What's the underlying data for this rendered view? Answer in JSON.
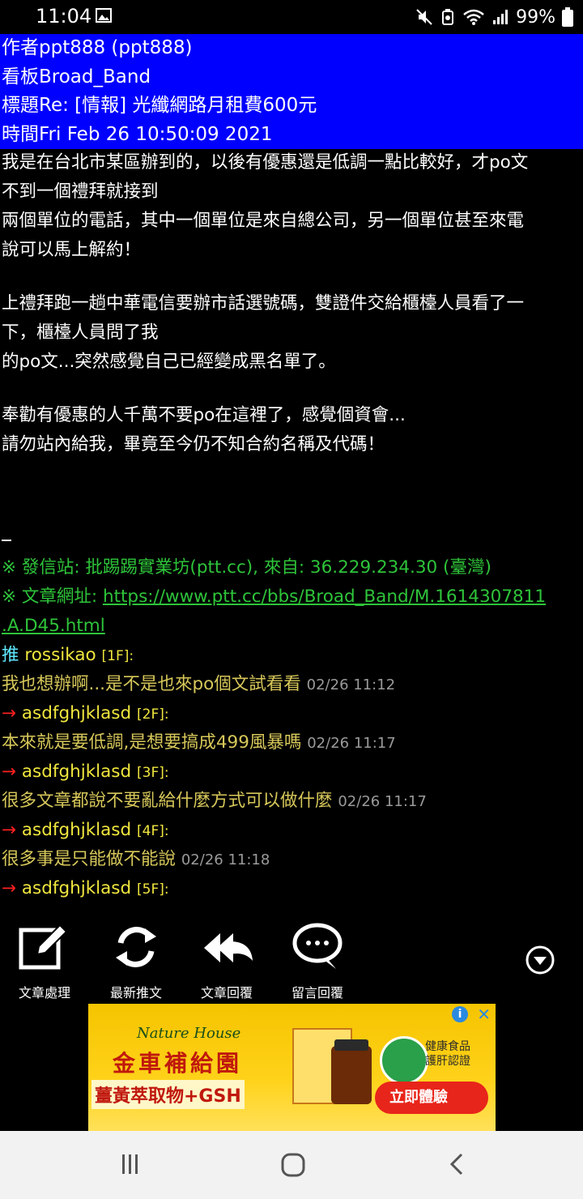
{
  "status_bar": {
    "time": "11:04",
    "battery_percent": "99%",
    "icons": [
      "image-icon",
      "mute-icon",
      "alarm-icon",
      "wifi-icon",
      "signal-icon",
      "battery-icon"
    ]
  },
  "header": {
    "author": "作者ppt888 (ppt888)",
    "board": "看板Broad_Band",
    "title": "標題Re: [情報] 光纖網路月租費600元",
    "time": "時間Fri Feb 26 10:50:09 2021"
  },
  "body_lines": [
    "我是在台北市某區辦到的，以後有優惠還是低調一點比較好，才po文",
    "不到一個禮拜就接到",
    "兩個單位的電話，其中一個單位是來自總公司，另一個單位甚至來電",
    "說可以馬上解約！",
    "上禮拜跑一趟中華電信要辦市話選號碼，雙證件交給櫃檯人員看了一",
    "下，櫃檯人員問了我",
    "的po文...突然感覺自己已經變成黑名單了。",
    "奉勸有優惠的人千萬不要po在這裡了，感覺個資會...",
    "請勿站內給我，畢竟至今仍不知合約名稱及代碼！"
  ],
  "signature": {
    "sent_from": "※ 發信站: 批踢踢實業坊(ptt.cc), 來自: 36.229.234.30 (臺灣)",
    "url_label": "※ 文章網址: ",
    "url_line1": "https://www.ptt.cc/bbs/Broad_Band/M.1614307811",
    "url_line2": ".A.D45.html"
  },
  "comments": [
    {
      "type": "推",
      "user": "rossikao",
      "floor": "[1F]:",
      "text": "我也想辦啊...是不是也來po個文試看看",
      "time": "02/26 11:12"
    },
    {
      "type": "→",
      "user": "asdfghjklasd",
      "floor": "[2F]:",
      "text": "本來就是要低調,是想要搞成499風暴嗎",
      "time": "02/26 11:17"
    },
    {
      "type": "→",
      "user": "asdfghjklasd",
      "floor": "[3F]:",
      "text": "很多文章都說不要亂給什麼方式可以做什麼",
      "time": "02/26 11:17"
    },
    {
      "type": "→",
      "user": "asdfghjklasd",
      "floor": "[4F]:",
      "text": "很多事是只能做不能說",
      "time": "02/26 11:18"
    },
    {
      "type": "→",
      "user": "asdfghjklasd",
      "floor": "[5F]:",
      "text": "",
      "time": ""
    }
  ],
  "toolbar": {
    "article_actions": "文章處理",
    "latest_push": "最新推文",
    "reply_article": "文章回覆",
    "reply_comment": "留言回覆"
  },
  "ad": {
    "brand": "Nature House",
    "title": "金車補給園",
    "subtitle": "薑黃萃取物+GSH",
    "badge_text": "健康食品\n護肝認證",
    "cta": "立即體驗",
    "info_icon": "info-icon",
    "close_icon": "close-icon"
  },
  "colors": {
    "header_bg": "#0000ff",
    "signature": "#2ec43a",
    "push_user": "#f0e63e",
    "comment_text": "#d7c85a",
    "arrow": "#ff2020"
  }
}
